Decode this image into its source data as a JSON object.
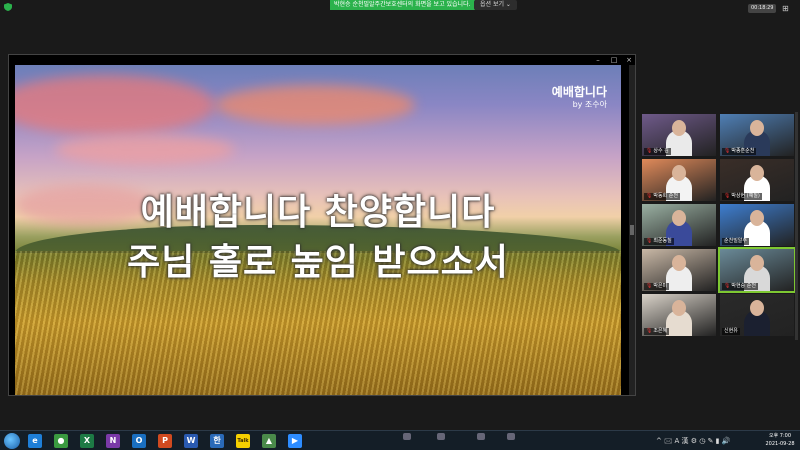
{
  "topbar": {
    "share_banner": "박현승 순천밀알주간보호센터의 화면을 보고 있습니다.",
    "view_options": "옵션 보기 ⌄",
    "clock_chip": "00:18:29",
    "grid_icon": "grid-view-icon"
  },
  "slide": {
    "watermark_title": "예배합니다",
    "watermark_sub": "by 조수아",
    "lyric_line1": "예배합니다 찬양합니다",
    "lyric_line2": "주님 홀로 높임 받으소서"
  },
  "share_window": {
    "minimize": "–",
    "maximize": "□",
    "close": "×"
  },
  "participants": [
    {
      "name": "상수 김",
      "bg": "#6f5a8a",
      "shirt": "#eaeaea",
      "muted": true
    },
    {
      "name": "박종훈순천",
      "bg": "#4f7fb5",
      "shirt": "#2a3a5a",
      "muted": true
    },
    {
      "name": "박동희 순천",
      "bg": "#e08a5a",
      "shirt": "#f3f3f3",
      "muted": true
    },
    {
      "name": "박상현 (예칠)",
      "bg": "#3a2e28",
      "shirt": "#ffffff",
      "muted": true
    },
    {
      "name": "최준동칠",
      "bg": "#9ab0a2",
      "shirt": "#3a4a9a",
      "muted": true
    },
    {
      "name": "순천밀알주",
      "bg": "#3e7ed0",
      "shirt": "#ffffff",
      "muted": false
    },
    {
      "name": "박은미",
      "bg": "#c9b8a6",
      "shirt": "#eeeeee",
      "muted": true
    },
    {
      "name": "박현승 순천",
      "bg": "#6a8a98",
      "shirt": "#d9d9d9",
      "muted": true
    },
    {
      "name": "조은혜",
      "bg": "#d9d2c8",
      "shirt": "#e6dcd0",
      "muted": true
    },
    {
      "name": "신현유",
      "bg": "#2a2a2a",
      "shirt": "#1b2030",
      "muted": false
    }
  ],
  "taskbar": {
    "apps": [
      {
        "icon": "ie-icon",
        "glyph": "e",
        "color": "#1e7fd8"
      },
      {
        "icon": "chrome-icon",
        "glyph": "●",
        "color": "#3a9a40"
      },
      {
        "icon": "excel-icon",
        "glyph": "X",
        "color": "#1d7a45"
      },
      {
        "icon": "onenote-icon",
        "glyph": "N",
        "color": "#7a3aa8"
      },
      {
        "icon": "outlook-icon",
        "glyph": "O",
        "color": "#1a6fc0"
      },
      {
        "icon": "powerpoint-icon",
        "glyph": "P",
        "color": "#d04a20"
      },
      {
        "icon": "word-icon",
        "glyph": "W",
        "color": "#2a5ab0"
      },
      {
        "icon": "hwp-icon",
        "glyph": "한",
        "color": "#2a6ab8"
      },
      {
        "icon": "kakaotalk-icon",
        "glyph": "Talk",
        "color": "#f5d000"
      },
      {
        "icon": "gallery-icon",
        "glyph": "▲",
        "color": "#4a8a4a"
      },
      {
        "icon": "zoom-icon",
        "glyph": "▶",
        "color": "#2d8cff"
      }
    ],
    "tray": "^ 🖂 A 漢 ⚙ ◷ ✎ ▮ 🔊",
    "time": "오후 7:00",
    "date": "2021-09-28"
  }
}
